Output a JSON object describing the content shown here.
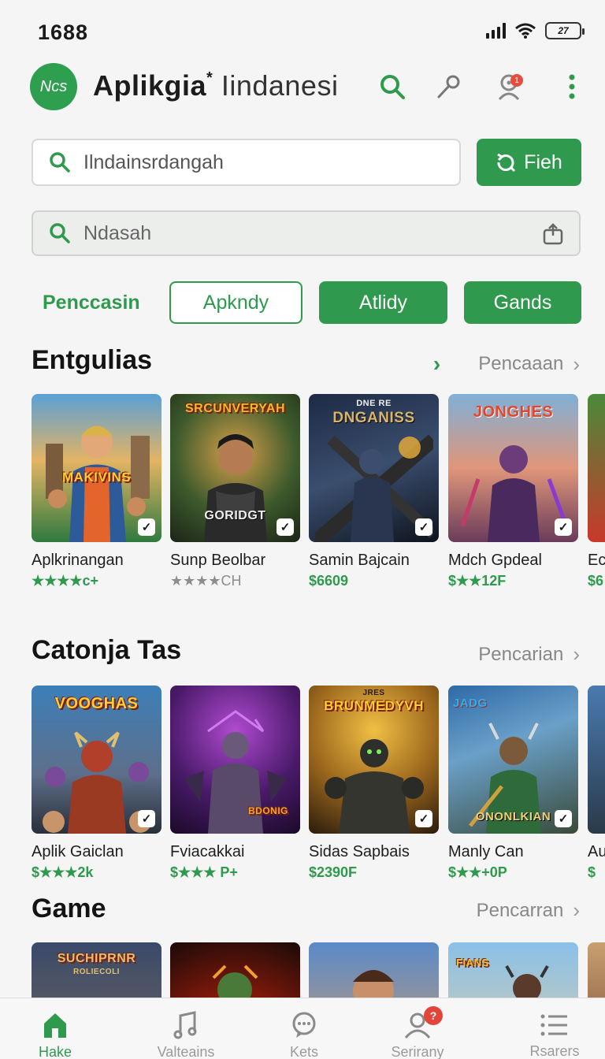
{
  "status": {
    "time": "1688",
    "battery": "27"
  },
  "header": {
    "avatar_initials": "Ncs",
    "title": "Aplikgia",
    "title_mark": "*",
    "title_sub": "Iindanesi",
    "notification_count": "1"
  },
  "search": {
    "placeholder": "Ilndainsrdangah",
    "button_label": "Fieh",
    "secondary_placeholder": "Ndasah"
  },
  "filters": {
    "active_text": "Penccasin",
    "chip_outline": "Apkndy",
    "chip_filled_1": "Atlidy",
    "chip_filled_2": "Gands"
  },
  "sections": [
    {
      "title": "Entgulias",
      "more_label": "Pencaaan",
      "items": [
        {
          "name": "Aplkrinangan",
          "price": "★★★★c+",
          "art_title": "MAKIVINS"
        },
        {
          "name": "Sunp Beolbar",
          "price": "★★★★CH",
          "art_title": "SRCUNVERYAH",
          "art_subtitle": "GORIDGT"
        },
        {
          "name": "Samin Bajcain",
          "price": "$6609",
          "art_title": "DNGANISS",
          "art_top": "DNE RE"
        },
        {
          "name": "Mdch Gpdeal",
          "price": "$★★12F",
          "art_title": "JONGHES"
        },
        {
          "name": "Ec",
          "price": "$6"
        }
      ]
    },
    {
      "title": "Catonja Tas",
      "more_label": "Pencarian",
      "items": [
        {
          "name": "Aplik Gaiclan",
          "price": "$★★★2k",
          "art_title": "VOOGHAS"
        },
        {
          "name": "Fviacakkai",
          "price": "$★★★ P+",
          "art_title": "BDONIG"
        },
        {
          "name": "Sidas Sapbais",
          "price": "$2390F",
          "art_title": "BRUNMEDYVH",
          "art_top": "JRES"
        },
        {
          "name": "Manly Can",
          "price": "$★★+0P",
          "art_title": "ONONLKIAN",
          "art_top": "JADG"
        },
        {
          "name": "Au",
          "price": "$"
        }
      ]
    },
    {
      "title": "Game",
      "more_label": "Pencarran",
      "items": [
        {
          "art_title": "SUCHIPRNR",
          "art_subtitle": "ROLIECOLI"
        },
        {
          "art_title": ""
        },
        {
          "art_title": ""
        },
        {
          "art_title": "FIANS"
        },
        {
          "art_title": ""
        }
      ]
    }
  ],
  "tabbar": [
    {
      "label": "Hake"
    },
    {
      "label": "Valteains"
    },
    {
      "label": "Kets"
    },
    {
      "label": "Serirany",
      "badge": "?"
    },
    {
      "label": "Rsarers"
    }
  ],
  "colors": {
    "accent": "#2f9a4e",
    "badge": "#e2463a"
  }
}
